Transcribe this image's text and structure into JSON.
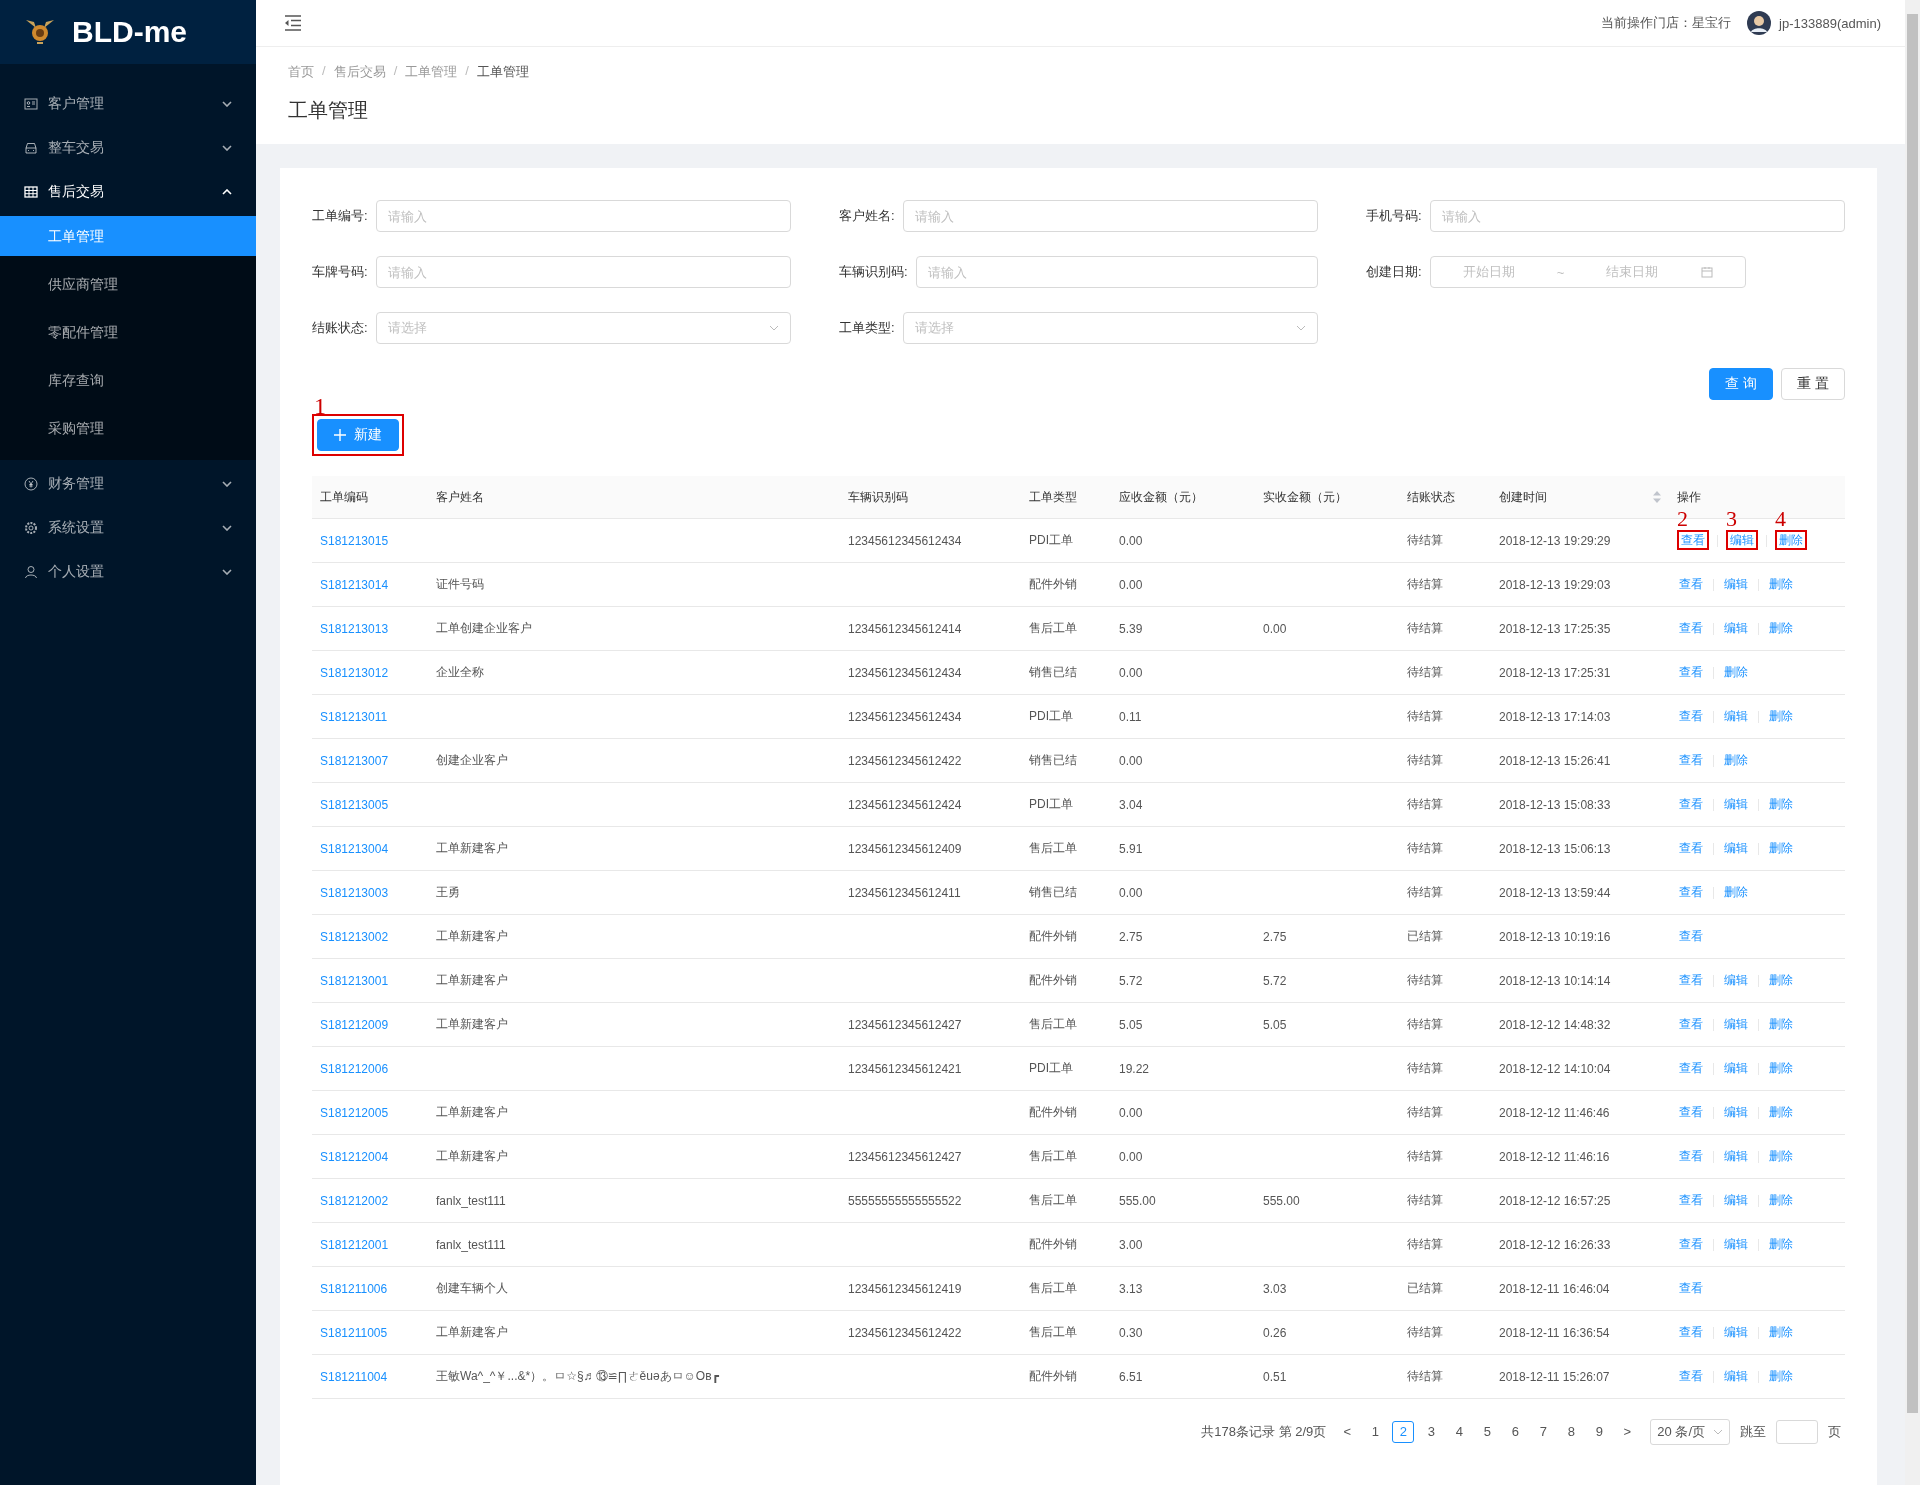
{
  "brand": "BLD-me",
  "sidebar": {
    "items": [
      {
        "label": "客户管理",
        "expanded": false
      },
      {
        "label": "整车交易",
        "expanded": false
      },
      {
        "label": "售后交易",
        "expanded": true,
        "children": [
          {
            "label": "工单管理",
            "selected": true
          },
          {
            "label": "供应商管理",
            "selected": false
          },
          {
            "label": "零配件管理",
            "selected": false
          },
          {
            "label": "库存查询",
            "selected": false
          },
          {
            "label": "采购管理",
            "selected": false
          }
        ]
      },
      {
        "label": "财务管理",
        "expanded": false
      },
      {
        "label": "系统设置",
        "expanded": false
      },
      {
        "label": "个人设置",
        "expanded": false
      }
    ]
  },
  "header": {
    "store": "当前操作门店：星宝行",
    "user": "jp-133889(admin)"
  },
  "breadcrumb": [
    "首页",
    "售后交易",
    "工单管理",
    "工单管理"
  ],
  "breadcrumb_separator": "/",
  "page_title": "工单管理",
  "filters": [
    {
      "label": "工单编号:",
      "kind": "input",
      "placeholder": "请输入"
    },
    {
      "label": "客户姓名:",
      "kind": "input",
      "placeholder": "请输入"
    },
    {
      "label": "手机号码:",
      "kind": "input",
      "placeholder": "请输入"
    },
    {
      "label": "车牌号码:",
      "kind": "input",
      "placeholder": "请输入"
    },
    {
      "label": "车辆识别码:",
      "kind": "input",
      "placeholder": "请输入"
    },
    {
      "label": "创建日期:",
      "kind": "daterange",
      "start_placeholder": "开始日期",
      "separator": "~",
      "end_placeholder": "结束日期"
    },
    {
      "label": "结账状态:",
      "kind": "select",
      "placeholder": "请选择"
    },
    {
      "label": "工单类型:",
      "kind": "select",
      "placeholder": "请选择"
    }
  ],
  "query_button": "查 询",
  "reset_button": "重 置",
  "new_button": {
    "label": "新建",
    "callout": "1"
  },
  "table": {
    "columns": [
      "工单编码",
      "客户姓名",
      "车辆识别码",
      "工单类型",
      "应收金额（元）",
      "实收金额（元）",
      "结账状态",
      "创建时间",
      "操作"
    ],
    "rows": [
      {
        "id": "S181213015",
        "vin": "12345612345612434",
        "type": "PDI工单",
        "receivable": "0.00",
        "status": "待结算",
        "created": "2018-12-13 19:29:29",
        "actions": [
          {
            "label": "查看",
            "callout": "2"
          },
          {
            "label": "编辑",
            "callout": "3"
          },
          {
            "label": "删除",
            "callout": "4"
          }
        ]
      },
      {
        "id": "S181213014",
        "name": "证件号码",
        "type": "配件外销",
        "receivable": "0.00",
        "status": "待结算",
        "created": "2018-12-13 19:29:03",
        "actions": [
          {
            "label": "查看"
          },
          {
            "label": "编辑"
          },
          {
            "label": "删除"
          }
        ]
      },
      {
        "id": "S181213013",
        "name": "工单创建企业客户",
        "vin": "12345612345612414",
        "type": "售后工单",
        "receivable": "5.39",
        "received": "0.00",
        "status": "待结算",
        "created": "2018-12-13 17:25:35",
        "actions": [
          {
            "label": "查看"
          },
          {
            "label": "编辑"
          },
          {
            "label": "删除"
          }
        ]
      },
      {
        "id": "S181213012",
        "name": "企业全称",
        "vin": "12345612345612434",
        "type": "销售已结",
        "receivable": "0.00",
        "status": "待结算",
        "created": "2018-12-13 17:25:31",
        "actions": [
          {
            "label": "查看"
          },
          {
            "label": "删除"
          }
        ]
      },
      {
        "id": "S181213011",
        "vin": "12345612345612434",
        "type": "PDI工单",
        "receivable": "0.11",
        "status": "待结算",
        "created": "2018-12-13 17:14:03",
        "actions": [
          {
            "label": "查看"
          },
          {
            "label": "编辑"
          },
          {
            "label": "删除"
          }
        ]
      },
      {
        "id": "S181213007",
        "name": "创建企业客户",
        "vin": "12345612345612422",
        "type": "销售已结",
        "receivable": "0.00",
        "status": "待结算",
        "created": "2018-12-13 15:26:41",
        "actions": [
          {
            "label": "查看"
          },
          {
            "label": "删除"
          }
        ]
      },
      {
        "id": "S181213005",
        "vin": "12345612345612424",
        "type": "PDI工单",
        "receivable": "3.04",
        "status": "待结算",
        "created": "2018-12-13 15:08:33",
        "actions": [
          {
            "label": "查看"
          },
          {
            "label": "编辑"
          },
          {
            "label": "删除"
          }
        ]
      },
      {
        "id": "S181213004",
        "name": "工单新建客户",
        "vin": "12345612345612409",
        "type": "售后工单",
        "receivable": "5.91",
        "status": "待结算",
        "created": "2018-12-13 15:06:13",
        "actions": [
          {
            "label": "查看"
          },
          {
            "label": "编辑"
          },
          {
            "label": "删除"
          }
        ]
      },
      {
        "id": "S181213003",
        "name": "王勇",
        "vin": "12345612345612411",
        "type": "销售已结",
        "receivable": "0.00",
        "status": "待结算",
        "created": "2018-12-13 13:59:44",
        "actions": [
          {
            "label": "查看"
          },
          {
            "label": "删除"
          }
        ]
      },
      {
        "id": "S181213002",
        "name": "工单新建客户",
        "type": "配件外销",
        "receivable": "2.75",
        "received": "2.75",
        "status": "已结算",
        "created": "2018-12-13 10:19:16",
        "actions": [
          {
            "label": "查看"
          }
        ]
      },
      {
        "id": "S181213001",
        "name": "工单新建客户",
        "type": "配件外销",
        "receivable": "5.72",
        "received": "5.72",
        "status": "待结算",
        "created": "2018-12-13 10:14:14",
        "actions": [
          {
            "label": "查看"
          },
          {
            "label": "编辑"
          },
          {
            "label": "删除"
          }
        ]
      },
      {
        "id": "S181212009",
        "name": "工单新建客户",
        "vin": "12345612345612427",
        "type": "售后工单",
        "receivable": "5.05",
        "received": "5.05",
        "status": "待结算",
        "created": "2018-12-12 14:48:32",
        "actions": [
          {
            "label": "查看"
          },
          {
            "label": "编辑"
          },
          {
            "label": "删除"
          }
        ]
      },
      {
        "id": "S181212006",
        "vin": "12345612345612421",
        "type": "PDI工单",
        "receivable": "19.22",
        "status": "待结算",
        "created": "2018-12-12 14:10:04",
        "actions": [
          {
            "label": "查看"
          },
          {
            "label": "编辑"
          },
          {
            "label": "删除"
          }
        ]
      },
      {
        "id": "S181212005",
        "name": "工单新建客户",
        "type": "配件外销",
        "receivable": "0.00",
        "status": "待结算",
        "created": "2018-12-12 11:46:46",
        "actions": [
          {
            "label": "查看"
          },
          {
            "label": "编辑"
          },
          {
            "label": "删除"
          }
        ]
      },
      {
        "id": "S181212004",
        "name": "工单新建客户",
        "vin": "12345612345612427",
        "type": "售后工单",
        "receivable": "0.00",
        "status": "待结算",
        "created": "2018-12-12 11:46:16",
        "actions": [
          {
            "label": "查看"
          },
          {
            "label": "编辑"
          },
          {
            "label": "删除"
          }
        ]
      },
      {
        "id": "S181212002",
        "name": "fanlx_test111",
        "vin": "55555555555555522",
        "type": "售后工单",
        "receivable": "555.00",
        "received": "555.00",
        "status": "待结算",
        "created": "2018-12-12 16:57:25",
        "actions": [
          {
            "label": "查看"
          },
          {
            "label": "编辑"
          },
          {
            "label": "删除"
          }
        ]
      },
      {
        "id": "S181212001",
        "name": "fanlx_test111",
        "type": "配件外销",
        "receivable": "3.00",
        "status": "待结算",
        "created": "2018-12-12 16:26:33",
        "actions": [
          {
            "label": "查看"
          },
          {
            "label": "编辑"
          },
          {
            "label": "删除"
          }
        ]
      },
      {
        "id": "S181211006",
        "name": "创建车辆个人",
        "vin": "12345612345612419",
        "type": "售后工单",
        "receivable": "3.13",
        "received": "3.03",
        "status": "已结算",
        "created": "2018-12-11 16:46:04",
        "actions": [
          {
            "label": "查看"
          }
        ]
      },
      {
        "id": "S181211005",
        "name": "工单新建客户",
        "vin": "12345612345612422",
        "type": "售后工单",
        "receivable": "0.30",
        "received": "0.26",
        "status": "待结算",
        "created": "2018-12-11 16:36:54",
        "actions": [
          {
            "label": "查看"
          },
          {
            "label": "编辑"
          },
          {
            "label": "删除"
          }
        ]
      },
      {
        "id": "S181211004",
        "name": "王敏Wa^_^￥...&*）。ㅁ☆§♬⑬≌∏ㄜěuəあㅁ☺Oв┏",
        "type": "配件外销",
        "receivable": "6.51",
        "received": "0.51",
        "status": "待结算",
        "created": "2018-12-11 15:26:07",
        "actions": [
          {
            "label": "查看"
          },
          {
            "label": "编辑"
          },
          {
            "label": "删除"
          }
        ]
      }
    ]
  },
  "pagination": {
    "summary": "共178条记录 第 2/9页",
    "prev": "<",
    "pages": [
      {
        "label": "1",
        "selected": false
      },
      {
        "label": "2",
        "selected": true
      },
      {
        "label": "3",
        "selected": false
      },
      {
        "label": "4",
        "selected": false
      },
      {
        "label": "5",
        "selected": false
      },
      {
        "label": "6",
        "selected": false
      },
      {
        "label": "7",
        "selected": false
      },
      {
        "label": "8",
        "selected": false
      },
      {
        "label": "9",
        "selected": false
      }
    ],
    "next": ">",
    "page_size": "20 条/页",
    "jump_label": "跳至",
    "jump_suffix": "页"
  }
}
